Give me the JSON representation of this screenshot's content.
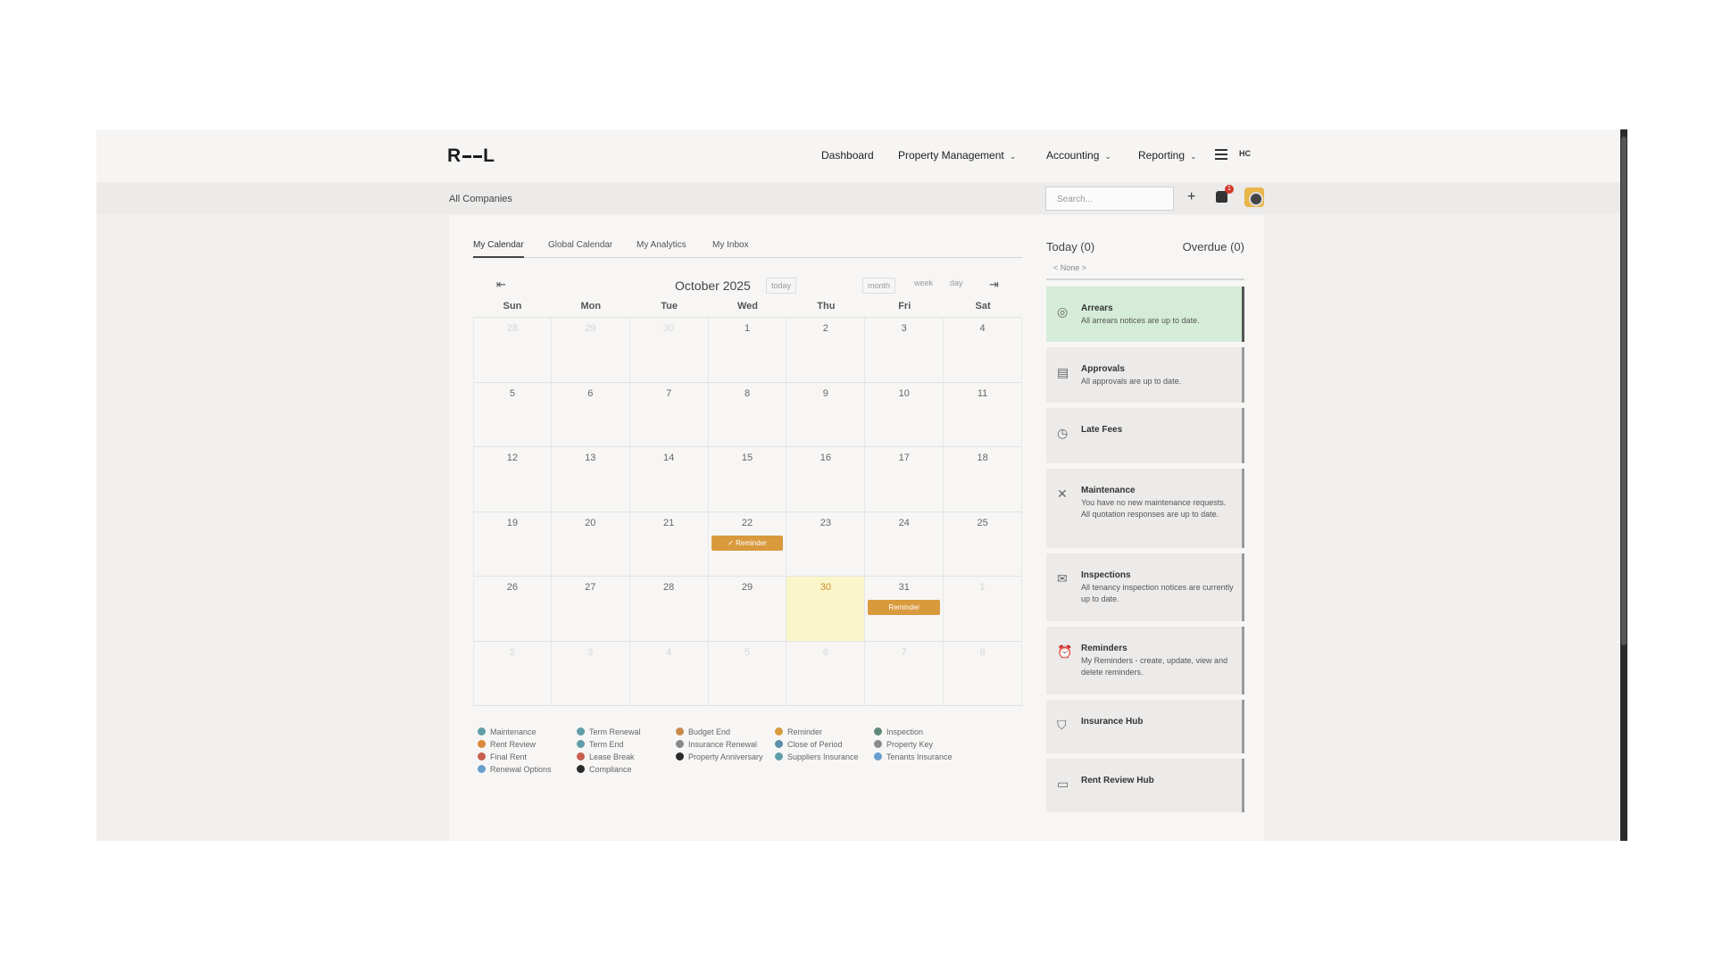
{
  "brand": {
    "logo_left": "R",
    "logo_right": "L"
  },
  "nav": {
    "dashboard": "Dashboard",
    "property_management": "Property Management",
    "accounting": "Accounting",
    "reporting": "Reporting",
    "user_initials": "HC"
  },
  "subbar": {
    "breadcrumb": "All Companies",
    "search_placeholder": "Search...",
    "notification_count": "1"
  },
  "tabs": [
    "My Calendar",
    "Global Calendar",
    "My Analytics",
    "My Inbox"
  ],
  "calendar": {
    "title": "October 2025",
    "today_label": "today",
    "views": [
      "month",
      "week",
      "day"
    ],
    "weekdays": [
      "Sun",
      "Mon",
      "Tue",
      "Wed",
      "Thu",
      "Fri",
      "Sat"
    ],
    "weeks": [
      [
        "28",
        "29",
        "30",
        "1",
        "2",
        "3",
        "4"
      ],
      [
        "5",
        "6",
        "7",
        "8",
        "9",
        "10",
        "11"
      ],
      [
        "12",
        "13",
        "14",
        "15",
        "16",
        "17",
        "18"
      ],
      [
        "19",
        "20",
        "21",
        "22",
        "23",
        "24",
        "25"
      ],
      [
        "26",
        "27",
        "28",
        "29",
        "30",
        "31",
        "1"
      ],
      [
        "2",
        "3",
        "4",
        "5",
        "6",
        "7",
        "8"
      ]
    ],
    "events": [
      {
        "date": "22",
        "label": "✓ Reminder"
      },
      {
        "date": "31",
        "label": "Reminder"
      }
    ],
    "today": "30"
  },
  "legend": [
    {
      "label": "Maintenance",
      "color": "#5f9ea8"
    },
    {
      "label": "Rent Review",
      "color": "#d9893a"
    },
    {
      "label": "Final Rent",
      "color": "#c95f4f"
    },
    {
      "label": "Renewal Options",
      "color": "#6a9ecf"
    },
    {
      "label": "Term Renewal",
      "color": "#5f9ea8"
    },
    {
      "label": "Term End",
      "color": "#5f9ea8"
    },
    {
      "label": "Lease Break",
      "color": "#c95f4f"
    },
    {
      "label": "Compliance",
      "color": "#2a2a2a"
    },
    {
      "label": "Budget End",
      "color": "#c98a4a"
    },
    {
      "label": "Insurance Renewal",
      "color": "#8a8a8a"
    },
    {
      "label": "Property Anniversary",
      "color": "#2a2a2a"
    },
    {
      "label": "Reminder",
      "color": "#d99a3e"
    },
    {
      "label": "Close of Period",
      "color": "#5f8ea8"
    },
    {
      "label": "Suppliers Insurance",
      "color": "#5f9ea8"
    },
    {
      "label": "Inspection",
      "color": "#5f8a7a"
    },
    {
      "label": "Property Key",
      "color": "#8a8a8a"
    },
    {
      "label": "Tenants Insurance",
      "color": "#6a9ecf"
    }
  ],
  "sidebar": {
    "today": "Today (0)",
    "overdue": "Overdue (0)",
    "none": "< None >",
    "cards": [
      {
        "title": "Arrears",
        "desc": "All arrears notices are up to date.",
        "icon": "check-circle-icon"
      },
      {
        "title": "Approvals",
        "desc": "All approvals are up to date.",
        "icon": "document-icon"
      },
      {
        "title": "Late Fees",
        "desc": "",
        "icon": "clock-icon"
      },
      {
        "title": "Maintenance",
        "desc": "You have no new maintenance requests.\nAll quotation responses are up to date.",
        "icon": "tools-icon"
      },
      {
        "title": "Inspections",
        "desc": "All tenancy inspection notices are currently up to date.",
        "icon": "envelope-icon"
      },
      {
        "title": "Reminders",
        "desc": "My Reminders - create, update, view and delete reminders.",
        "icon": "alarm-icon"
      },
      {
        "title": "Insurance Hub",
        "desc": "",
        "icon": "shield-icon"
      },
      {
        "title": "Rent Review Hub",
        "desc": "",
        "icon": "card-icon"
      }
    ]
  },
  "colors": {
    "accent": "#d99a3e",
    "today_bg": "#fbf6c9",
    "ok_card": "#d5ecd8"
  }
}
